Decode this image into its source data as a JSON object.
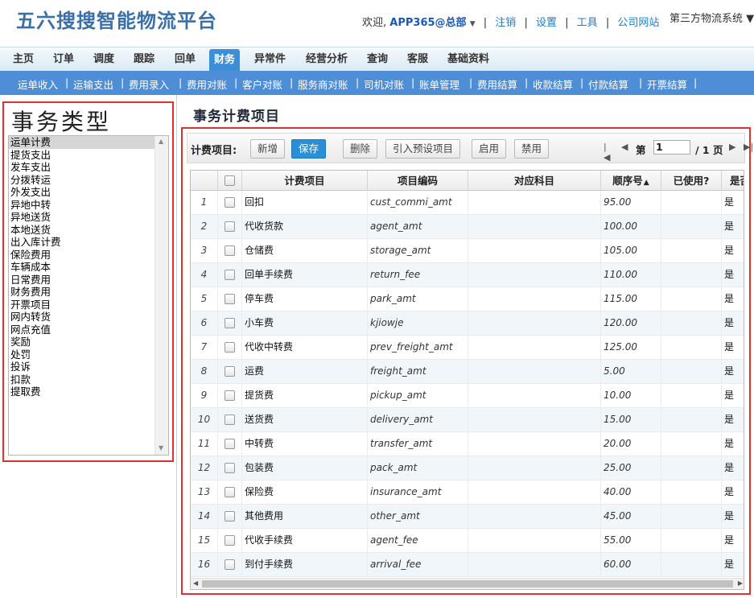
{
  "header": {
    "logo": "五六搜搜智能物流平台",
    "welcome": "欢迎,",
    "user": "APP365@总部",
    "links": [
      "注销",
      "设置",
      "工具",
      "公司网站"
    ],
    "system": "第三方物流系统"
  },
  "main_nav": {
    "items": [
      "主页",
      "订单",
      "调度",
      "跟踪",
      "回单",
      "财务",
      "异常件",
      "经营分析",
      "查询",
      "客服",
      "基础资料"
    ],
    "active": "财务"
  },
  "sub_nav": {
    "items": [
      "运单收入",
      "运输支出",
      "费用录入",
      "费用对账",
      "客户对账",
      "服务商对账",
      "司机对账",
      "账单管理",
      "费用结算",
      "收款结算",
      "付款结算",
      "开票结算"
    ]
  },
  "left_panel": {
    "title": "事务类型",
    "items": [
      "运单计费",
      "提货支出",
      "发车支出",
      "分拨转运",
      "外发支出",
      "异地中转",
      "异地送货",
      "本地送货",
      "出入库计费",
      "保险费用",
      "车辆成本",
      "日常费用",
      "财务费用",
      "开票项目",
      "网内转货",
      "网点充值",
      "奖励",
      "处罚",
      "投诉",
      "扣款",
      "提取费"
    ],
    "selected": "运单计费"
  },
  "section_title": "事务计费项目",
  "toolbar": {
    "label": "计费项目:",
    "buttons": [
      "新增",
      "保存",
      "删除",
      "引入预设项目",
      "启用",
      "禁用"
    ],
    "pager_prefix": "第",
    "page_value": "1",
    "page_total": "/ 1 页"
  },
  "grid": {
    "columns": [
      "计费项目",
      "项目编码",
      "对应科目",
      "顺序号",
      "已使用?",
      "是否"
    ],
    "sort_indicator": "▲",
    "rows": [
      {
        "no": "1",
        "name": "回扣",
        "code": "cust_commi_amt",
        "subject": "",
        "order": "95.00",
        "used": "",
        "last": "是"
      },
      {
        "no": "2",
        "name": "代收货款",
        "code": "agent_amt",
        "subject": "",
        "order": "100.00",
        "used": "",
        "last": "是"
      },
      {
        "no": "3",
        "name": "仓储费",
        "code": "storage_amt",
        "subject": "",
        "order": "105.00",
        "used": "",
        "last": "是"
      },
      {
        "no": "4",
        "name": "回单手续费",
        "code": "return_fee",
        "subject": "",
        "order": "110.00",
        "used": "",
        "last": "是"
      },
      {
        "no": "5",
        "name": "停车费",
        "code": "park_amt",
        "subject": "",
        "order": "115.00",
        "used": "",
        "last": "是"
      },
      {
        "no": "6",
        "name": "小车费",
        "code": "kjiowje",
        "subject": "",
        "order": "120.00",
        "used": "",
        "last": "是"
      },
      {
        "no": "7",
        "name": "代收中转费",
        "code": "prev_freight_amt",
        "subject": "",
        "order": "125.00",
        "used": "",
        "last": "是"
      },
      {
        "no": "8",
        "name": "运费",
        "code": "freight_amt",
        "subject": "",
        "order": "5.00",
        "used": "",
        "last": "是"
      },
      {
        "no": "9",
        "name": "提货费",
        "code": "pickup_amt",
        "subject": "",
        "order": "10.00",
        "used": "",
        "last": "是"
      },
      {
        "no": "10",
        "name": "送货费",
        "code": "delivery_amt",
        "subject": "",
        "order": "15.00",
        "used": "",
        "last": "是"
      },
      {
        "no": "11",
        "name": "中转费",
        "code": "transfer_amt",
        "subject": "",
        "order": "20.00",
        "used": "",
        "last": "是"
      },
      {
        "no": "12",
        "name": "包装费",
        "code": "pack_amt",
        "subject": "",
        "order": "25.00",
        "used": "",
        "last": "是"
      },
      {
        "no": "13",
        "name": "保险费",
        "code": "insurance_amt",
        "subject": "",
        "order": "40.00",
        "used": "",
        "last": "是"
      },
      {
        "no": "14",
        "name": "其他费用",
        "code": "other_amt",
        "subject": "",
        "order": "45.00",
        "used": "",
        "last": "是"
      },
      {
        "no": "15",
        "name": "代收手续费",
        "code": "agent_fee",
        "subject": "",
        "order": "55.00",
        "used": "",
        "last": "是"
      },
      {
        "no": "16",
        "name": "到付手续费",
        "code": "arrival_fee",
        "subject": "",
        "order": "60.00",
        "used": "",
        "last": "是"
      }
    ]
  },
  "colors": {
    "nav_active": "#3b8fd9",
    "subnav_bg": "#4d8ed6",
    "highlight_border": "#e03030",
    "save_button": "#2a8fd6",
    "row_alt": "#f1f6fb"
  }
}
